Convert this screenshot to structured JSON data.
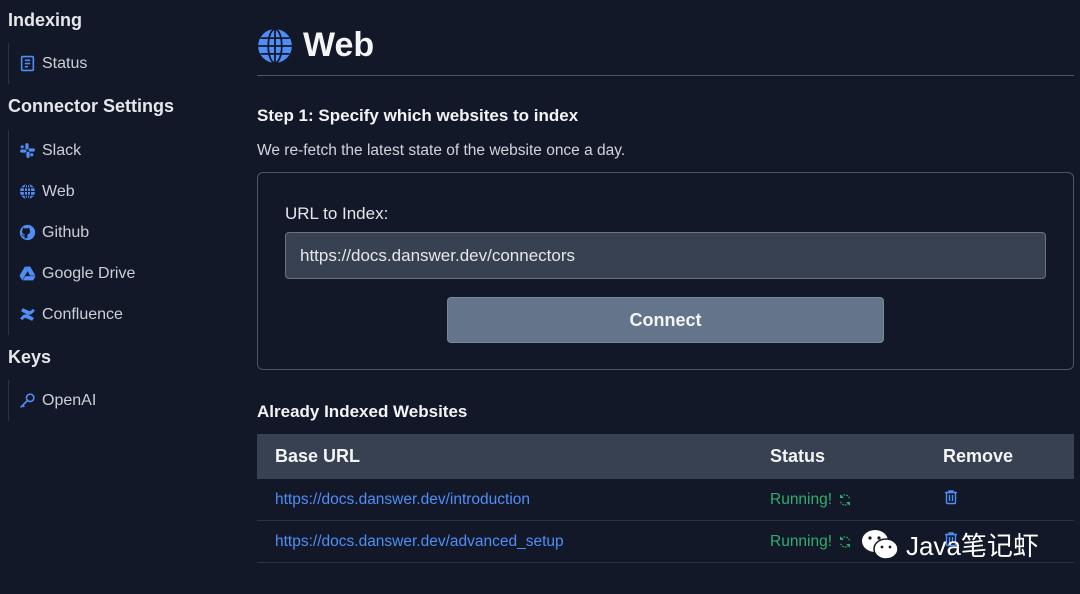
{
  "sidebar": {
    "indexing_title": "Indexing",
    "indexing_items": [
      {
        "label": "Status",
        "icon": "document-icon"
      }
    ],
    "connectors_title": "Connector Settings",
    "connector_items": [
      {
        "label": "Slack",
        "icon": "slack-icon"
      },
      {
        "label": "Web",
        "icon": "globe-icon"
      },
      {
        "label": "Github",
        "icon": "github-icon"
      },
      {
        "label": "Google Drive",
        "icon": "google-drive-icon"
      },
      {
        "label": "Confluence",
        "icon": "confluence-icon"
      }
    ],
    "keys_title": "Keys",
    "keys_items": [
      {
        "label": "OpenAI",
        "icon": "key-icon"
      }
    ]
  },
  "header": {
    "title": "Web",
    "icon": "globe-icon"
  },
  "step1": {
    "title": "Step 1: Specify which websites to index",
    "description": "We re-fetch the latest state of the website once a day.",
    "url_label": "URL to Index:",
    "url_value": "https://docs.danswer.dev/connectors",
    "connect_label": "Connect"
  },
  "indexed": {
    "title": "Already Indexed Websites",
    "columns": [
      "Base URL",
      "Status",
      "Remove"
    ],
    "rows": [
      {
        "url": "https://docs.danswer.dev/introduction",
        "status": "Running!"
      },
      {
        "url": "https://docs.danswer.dev/advanced_setup",
        "status": "Running!"
      }
    ]
  },
  "watermark": {
    "text": "Java笔记虾"
  },
  "colors": {
    "background": "#121827",
    "accent": "#4f8ef7",
    "status_green": "#2fae6e",
    "button": "#64748b"
  }
}
